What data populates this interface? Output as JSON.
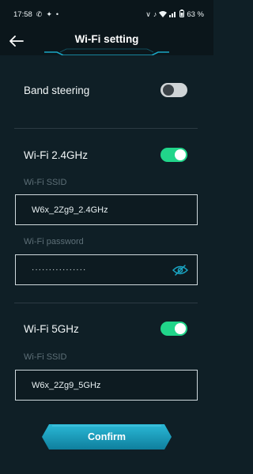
{
  "status_bar": {
    "time": "17:58",
    "battery": "63 %"
  },
  "header": {
    "title": "Wi-Fi setting"
  },
  "band_steering": {
    "label": "Band steering",
    "enabled": false
  },
  "wifi_24": {
    "label": "Wi-Fi 2.4GHz",
    "enabled": true,
    "ssid_label": "Wi-Fi SSID",
    "ssid_value": "W6x_2Zg9_2.4GHz",
    "password_label": "Wi-Fi password",
    "password_masked": "················"
  },
  "wifi_5": {
    "label": "Wi-Fi 5GHz",
    "enabled": true,
    "ssid_label": "Wi-Fi SSID",
    "ssid_value": "W6x_2Zg9_5GHz"
  },
  "confirm_label": "Confirm",
  "colors": {
    "accent": "#21d58a",
    "cyan": "#1aa6c4",
    "background": "#0f1f26"
  }
}
